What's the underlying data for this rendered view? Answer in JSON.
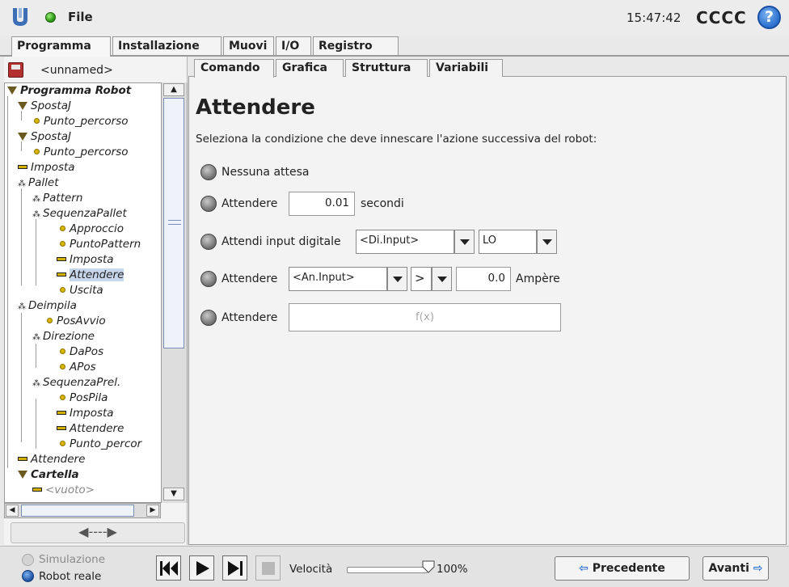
{
  "topbar": {
    "file_label": "File",
    "time": "15:47:42",
    "robot_name": "CCCC",
    "help_glyph": "?"
  },
  "main_tabs": [
    {
      "label": "Programma"
    },
    {
      "label": "Installazione"
    },
    {
      "label": "Muovi"
    },
    {
      "label": "I/O"
    },
    {
      "label": "Registro"
    }
  ],
  "left": {
    "program_name": "<unnamed>",
    "tree": [
      {
        "label": "Programma Robot",
        "icon": "triangle-icon",
        "bold": true
      },
      {
        "label": "SpostaJ",
        "icon": "triangle-icon"
      },
      {
        "label": "Punto_percorso",
        "icon": "point-icon"
      },
      {
        "label": "SpostaJ",
        "icon": "triangle-icon"
      },
      {
        "label": "Punto_percorso",
        "icon": "point-icon"
      },
      {
        "label": "Imposta",
        "icon": "bar-icon"
      },
      {
        "label": "Pallet",
        "icon": "pallet-icon"
      },
      {
        "label": "Pattern",
        "icon": "pallet-icon"
      },
      {
        "label": "SequenzaPallet",
        "icon": "pallet-icon"
      },
      {
        "label": "Approccio",
        "icon": "point-icon"
      },
      {
        "label": "PuntoPattern",
        "icon": "point-icon"
      },
      {
        "label": "Imposta",
        "icon": "bar-icon"
      },
      {
        "label": "Attendere",
        "icon": "bar-icon",
        "selected": true
      },
      {
        "label": "Uscita",
        "icon": "point-icon"
      },
      {
        "label": "Deimpila",
        "icon": "pallet-icon"
      },
      {
        "label": "PosAvvio",
        "icon": "point-icon"
      },
      {
        "label": "Direzione",
        "icon": "pallet-icon"
      },
      {
        "label": "DaPos",
        "icon": "point-icon"
      },
      {
        "label": "APos",
        "icon": "point-icon"
      },
      {
        "label": "SequenzaPrel.",
        "icon": "pallet-icon"
      },
      {
        "label": "PosPila",
        "icon": "point-icon"
      },
      {
        "label": "Imposta",
        "icon": "bar-icon"
      },
      {
        "label": "Attendere",
        "icon": "bar-icon"
      },
      {
        "label": "Punto_percor",
        "icon": "point-icon"
      },
      {
        "label": "Attendere",
        "icon": "bar-icon"
      },
      {
        "label": "Cartella",
        "icon": "triangle-icon",
        "bold": true
      },
      {
        "label": "<vuoto>",
        "icon": "bar-icon"
      }
    ],
    "collapse_glyph": "◀----▶"
  },
  "sub_tabs": [
    {
      "label": "Comando"
    },
    {
      "label": "Grafica"
    },
    {
      "label": "Struttura"
    },
    {
      "label": "Variabili"
    }
  ],
  "command": {
    "title": "Attendere",
    "description": "Seleziona la condizione che deve innescare l'azione successiva del robot:",
    "opt_no_wait": "Nessuna attesa",
    "opt_wait": "Attendere",
    "seconds_value": "0.01",
    "seconds_unit": "secondi",
    "opt_digital": "Attendi input digitale",
    "digital_input": "<Di.Input>",
    "digital_level": "LO",
    "analog_input": "<An.Input>",
    "comparator": ">",
    "analog_value": "0.0",
    "analog_unit": "Ampère",
    "expression_placeholder": "f(x)"
  },
  "bottom": {
    "simulation_label": "Simulazione",
    "real_label": "Robot reale",
    "speed_label": "Velocità",
    "speed_value": "100%",
    "speed_fraction": 1.0,
    "prev_label": "Precedente",
    "next_label": "Avanti"
  },
  "colors": {
    "accent_blue": "#2a6fcf",
    "status_green": "#2e9b17",
    "background": "#e9e9e9"
  }
}
